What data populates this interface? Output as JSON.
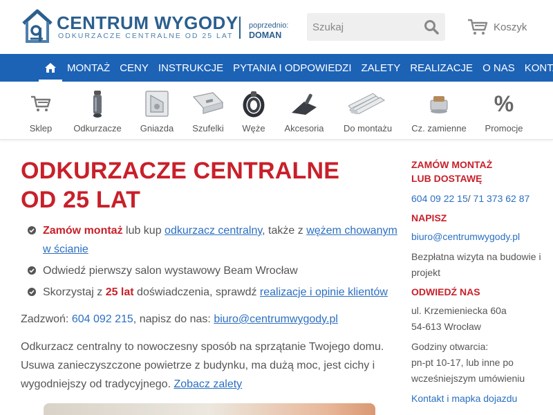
{
  "header": {
    "brand_title": "CENTRUM WYGODY",
    "brand_subtitle": "ODKURZACZE CENTRALNE OD 25 LAT",
    "previously_label": "poprzednio:",
    "previously_name": "DOMAN",
    "search_placeholder": "Szukaj",
    "cart_label": "Koszyk"
  },
  "nav": {
    "items": [
      "MONTAŻ",
      "CENY",
      "INSTRUKCJE",
      "PYTANIA I ODPOWIEDZI",
      "ZALETY",
      "REALIZACJE",
      "O NAS",
      "KONTAKT"
    ]
  },
  "categories": [
    {
      "label": "Sklep",
      "icon": "cart-icon"
    },
    {
      "label": "Odkurzacze",
      "icon": "vacuum-unit-icon"
    },
    {
      "label": "Gniazda",
      "icon": "wall-socket-icon"
    },
    {
      "label": "Szufelki",
      "icon": "dustpan-icon"
    },
    {
      "label": "Węże",
      "icon": "hose-icon"
    },
    {
      "label": "Akcesoria",
      "icon": "floor-brush-icon"
    },
    {
      "label": "Do montażu",
      "icon": "pipes-icon"
    },
    {
      "label": "Cz. zamienne",
      "icon": "motor-icon"
    },
    {
      "label": "Promocje",
      "icon": "percent-icon"
    }
  ],
  "main": {
    "title_line1": "ODKURZACZE CENTRALNE",
    "title_line2": "OD 25 LAT",
    "bullet1": {
      "strong": "Zamów montaż",
      "text1": " lub kup ",
      "link1": "odkurzacz centralny",
      "text2": ", także z ",
      "link2": "wężem chowanym w ścianie"
    },
    "bullet2": "Odwiedź pierwszy salon wystawowy Beam Wrocław",
    "bullet3": {
      "text1": "Skorzystaj z ",
      "strong": "25 lat",
      "text2": " doświadczenia, sprawdź ",
      "link": "realizacje i opinie klientów"
    },
    "contact": {
      "call_label": "Zadzwoń: ",
      "phone": "604 092 215",
      "write_label": ", napisz do nas: ",
      "email": "biuro@centrumwygody.pl"
    },
    "description": {
      "text": "Odkurzacz centralny to nowoczesny sposób na sprzątanie Twojego domu. Usuwa zanieczyszczone powietrze z budynku, ma dużą moc, jest cichy i wygodniejszy od tradycyjnego. ",
      "link": "Zobacz zalety"
    }
  },
  "sidebar": {
    "order_heading_1": "ZAMÓW MONTAŻ",
    "order_heading_2": "LUB DOSTAWĘ",
    "phone1": "604 09 22 15",
    "phone_sep": "/ ",
    "phone2": "71 373 62 87",
    "write_heading": "NAPISZ",
    "email": "biuro@centrumwygody.pl",
    "free_visit": "Bezpłatna wizyta na budowie i projekt",
    "visit_heading": "ODWIEDŹ NAS",
    "address1": "ul. Krzemieniecka 60a",
    "address2": "54-613 Wrocław",
    "hours_label": "Godziny otwarcia:",
    "hours": "pn-pt 10-17, lub inne po wcześniejszym umówieniu",
    "map_link": "Kontakt i mapka dojazdu"
  },
  "colors": {
    "nav_blue": "#1c62b5",
    "accent_red": "#c8202a",
    "link_blue": "#2a6fc2",
    "brand_blue": "#2b5f8e"
  }
}
